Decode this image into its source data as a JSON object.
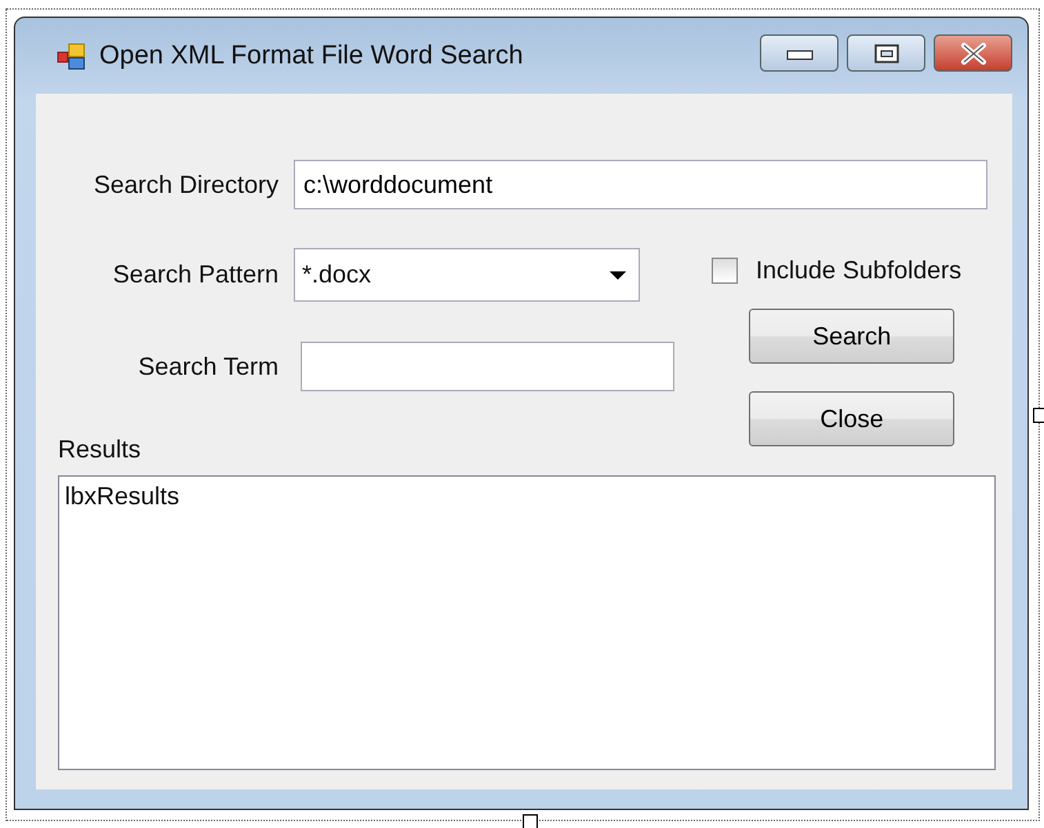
{
  "window": {
    "title": "Open XML Format File Word Search",
    "selected_in_designer": true
  },
  "directory": {
    "label": "Search Directory",
    "value": "c:\\worddocument"
  },
  "pattern": {
    "label": "Search Pattern",
    "value": "*.docx"
  },
  "subfolders": {
    "label": "Include Subfolders",
    "checked": false
  },
  "term": {
    "label": "Search Term"
  },
  "buttons": [
    "Search",
    "Close"
  ],
  "results": {
    "label": "Results",
    "items": [
      "lbxResults"
    ]
  }
}
